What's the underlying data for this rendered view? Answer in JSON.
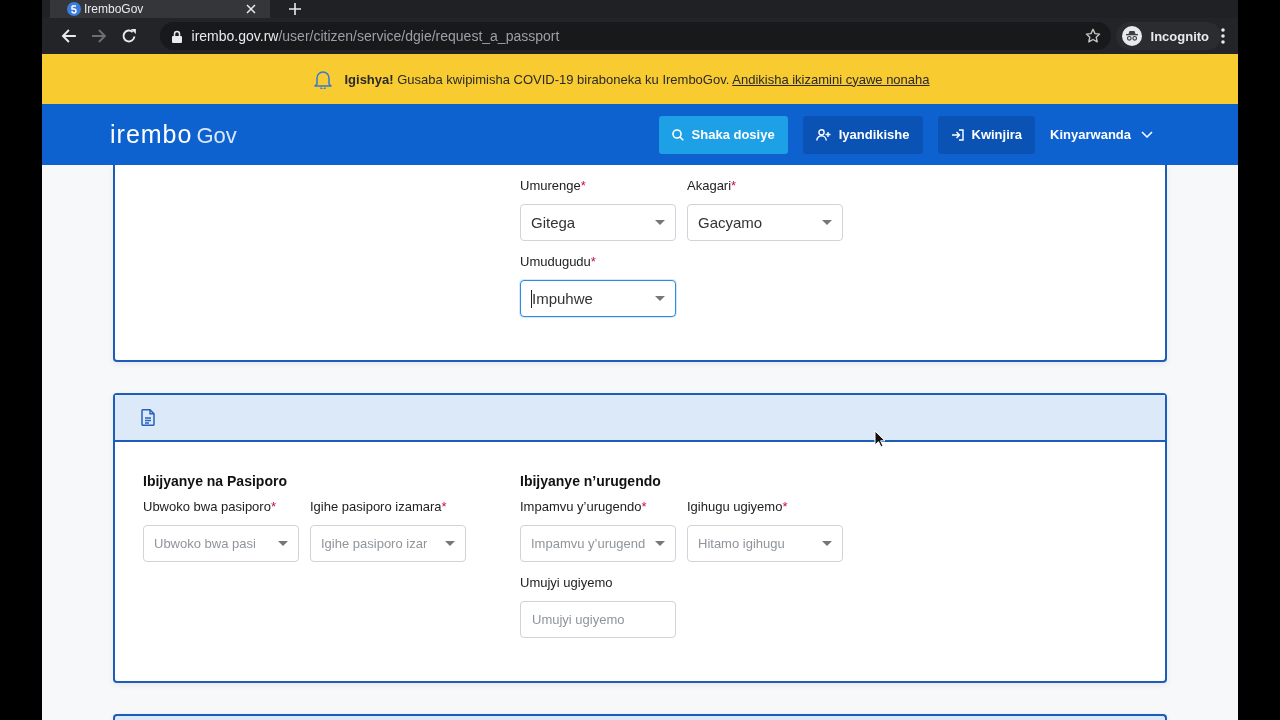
{
  "browser": {
    "tab": {
      "title": "IremboGov"
    },
    "nav": [
      {
        "kind": "back",
        "disabled": false
      },
      {
        "kind": "forward",
        "disabled": true
      },
      {
        "kind": "reload",
        "disabled": false
      }
    ],
    "address": {
      "host": "irembo.gov.rw",
      "path": "/user/citizen/service/dgie/request_a_passport"
    },
    "profile": "Incognito"
  },
  "banner": {
    "message": "**Igishya!** Gusaba kwipimisha COVID-19 biraboneka ku IremboGov.",
    "link": "Andikisha ikizamini cyawe nonaha"
  },
  "header": {
    "logo": {
      "name": "irembo",
      "suffix": "Gov"
    },
    "actions": [
      {
        "kind": "search",
        "label": "Shaka dosiye"
      },
      {
        "kind": "register",
        "label": "Iyandikishe"
      },
      {
        "kind": "login",
        "label": "Kwinjira"
      }
    ],
    "language": "Kinyarwanda"
  },
  "cards": [
    {
      "kind": "continued",
      "sections": [
        {
          "fields": [
            {
              "kind": "select",
              "label": "Umurenge",
              "required_mark": "*",
              "value": "Gitega",
              "focused": false
            },
            {
              "kind": "select",
              "label": "Akagari",
              "required_mark": "*",
              "value": "Gacyamo",
              "focused": false
            },
            {
              "kind": "select",
              "label": "Umudugudu",
              "required_mark": "*",
              "value": "Impuhwe",
              "focused": true
            }
          ]
        }
      ]
    },
    {
      "kind": "section",
      "sections": [
        {
          "title": "Ibijyanye na Pasiporo",
          "fields": [
            {
              "kind": "select",
              "label": "Ubwoko bwa pasiporo",
              "required_mark": "*",
              "placeholder": "Ubwoko bwa pasi",
              "focused": false
            },
            {
              "kind": "select",
              "label": "Igihe pasiporo izamara",
              "required_mark": "*",
              "placeholder": "Igihe pasiporo izar",
              "focused": false
            }
          ]
        },
        {
          "title": "Ibijyanye n’urugendo",
          "fields": [
            {
              "kind": "select",
              "label": "Impamvu y’urugendo",
              "required_mark": "*",
              "placeholder": "Impamvu y’urugend",
              "focused": false
            },
            {
              "kind": "select",
              "label": "Igihugu ugiyemo",
              "required_mark": "*",
              "placeholder": "Hitamo igihugu",
              "focused": false
            },
            {
              "kind": "text",
              "label": "Umujyi ugiyemo",
              "placeholder": "Umujyi ugiyemo",
              "focused": false
            }
          ]
        }
      ]
    },
    {
      "kind": "cut"
    }
  ]
}
